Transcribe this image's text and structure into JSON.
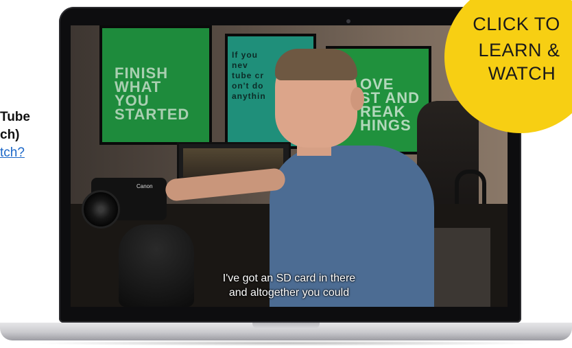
{
  "side_text": {
    "line1": "Tube",
    "line2": "ch)",
    "link": "tch?"
  },
  "video": {
    "subtitle_line1": "I've got an SD card in there",
    "subtitle_line2": "and altogether you could",
    "poster1_text": "FINISH\nWHAT\nYOU\nSTARTED",
    "poster2_text": "If you\nnev\ntube cr\non't do\nanythin",
    "poster3_text": "OVE\nST AND\nREAK\nHINGS",
    "camera_brand": "Canon"
  },
  "cta": {
    "line1": "CLICK TO",
    "line2": "LEARN &",
    "line3": "WATCH",
    "color": "#f7cf13"
  }
}
